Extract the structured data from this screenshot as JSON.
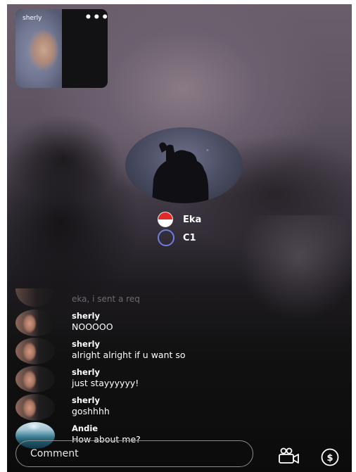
{
  "host_preview": {
    "name": "sherly",
    "more_label": "•••"
  },
  "participants": [
    {
      "name": "Eka"
    },
    {
      "name": "C1"
    }
  ],
  "chat": {
    "faded_message": "eka, i sent a req",
    "messages": [
      {
        "user": "sherly",
        "text": "NOOOOO"
      },
      {
        "user": "sherly",
        "text": "alright alright if u want so"
      },
      {
        "user": "sherly",
        "text": "just stayyyyyy!"
      },
      {
        "user": "sherly",
        "text": "goshhhh"
      },
      {
        "user": "Andie",
        "text": "How about me?"
      }
    ]
  },
  "bottom_bar": {
    "comment_placeholder": "Comment",
    "icons": [
      "video-camera-icon",
      "coin-dollar-icon"
    ]
  },
  "colors": {
    "flag_red": "#e12a2a",
    "ring_blue": "#6d7fe0",
    "background_dark": "#0b0b0b"
  }
}
